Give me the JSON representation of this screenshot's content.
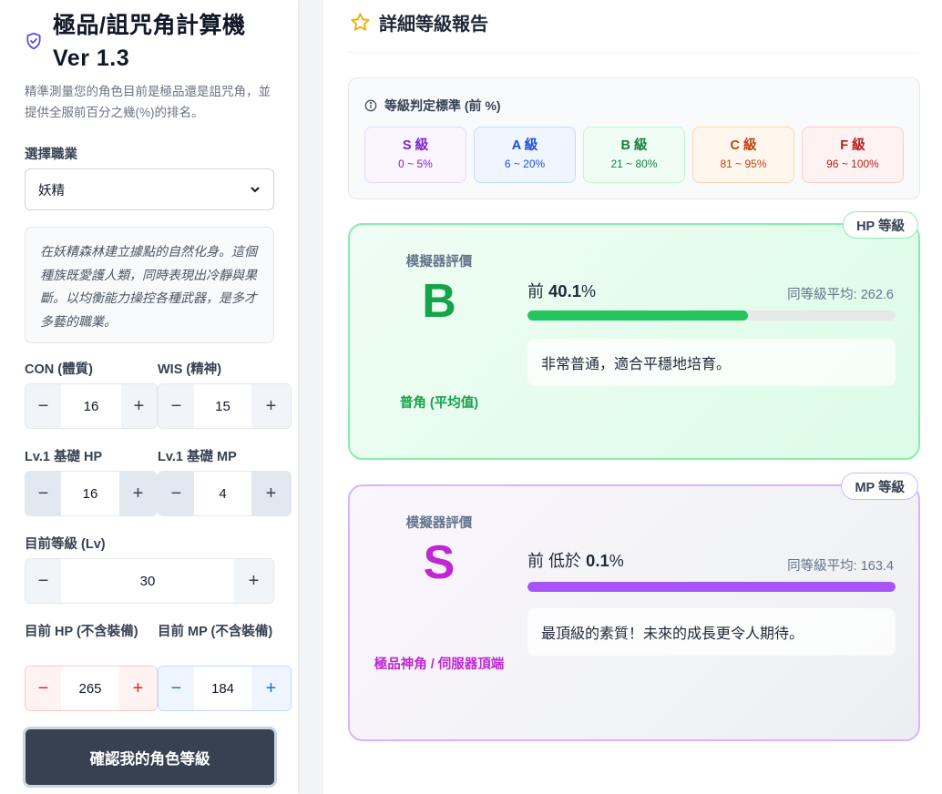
{
  "app": {
    "title": "極品/詛咒角計算機 Ver 1.3",
    "subtitle": "精準測量您的角色目前是極品還是詛咒角，並提供全服前百分之幾(%)的排名。"
  },
  "job": {
    "label": "選擇職業",
    "selected": "妖精",
    "description": "在妖精森林建立據點的自然化身。這個種族既愛護人類，同時表現出冷靜與果斷。以均衡能力操控各種武器，是多才多藝的職業。"
  },
  "stats": {
    "con": {
      "label": "CON (體質)",
      "value": "16"
    },
    "wis": {
      "label": "WIS (精神)",
      "value": "15"
    },
    "base_hp": {
      "label": "Lv.1 基礎 HP",
      "value": "16"
    },
    "base_mp": {
      "label": "Lv.1 基礎 MP",
      "value": "4"
    },
    "level": {
      "label": "目前等級 (Lv)",
      "value": "30"
    },
    "cur_hp": {
      "label": "目前 HP (不含裝備)",
      "value": "265"
    },
    "cur_mp": {
      "label": "目前 MP (不含裝備)",
      "value": "184"
    },
    "minus": "−",
    "plus": "+"
  },
  "confirm_label": "確認我的角色等級",
  "report": {
    "title": "詳細等級報告",
    "criteria_title": "等級判定標準 (前 %)",
    "grades": [
      {
        "name": "S 級",
        "range": "0 ~ 5%",
        "color": "#7e22ce",
        "bg": "#faf5ff",
        "border": "#e9d5ff"
      },
      {
        "name": "A 級",
        "range": "6 ~ 20%",
        "color": "#1d4ed8",
        "bg": "#eff6ff",
        "border": "#bfdbfe"
      },
      {
        "name": "B 級",
        "range": "21 ~ 80%",
        "color": "#15803d",
        "bg": "#f0fdf4",
        "border": "#bbf7d0"
      },
      {
        "name": "C 級",
        "range": "81 ~ 95%",
        "color": "#c2410c",
        "bg": "#fff7ed",
        "border": "#fed7aa"
      },
      {
        "name": "F 級",
        "range": "96 ~ 100%",
        "color": "#b91c1c",
        "bg": "#fef2f2",
        "border": "#fecaca"
      }
    ],
    "hp": {
      "badge": "HP 等級",
      "eval_label": "模擬器評價",
      "grade": "B",
      "tier": "普角 (平均值)",
      "pct_prefix": "前",
      "pct_value": "40.1",
      "pct_unit": "%",
      "progress": 0.599,
      "avg": "同等級平均: 262.6",
      "comment": "非常普通，適合平穩地培育。",
      "accent": "#16a34a",
      "bar_color": "#22c55e"
    },
    "mp": {
      "badge": "MP 等級",
      "eval_label": "模擬器評價",
      "grade": "S",
      "tier": "極品神角 / 伺服器頂端",
      "pct_prefix": "前 低於",
      "pct_value": "0.1",
      "pct_unit": "%",
      "progress": 0.999,
      "avg": "同等級平均: 163.4",
      "comment": "最頂級的素質！未來的成長更令人期待。",
      "accent": "#c026d3",
      "bar_color": "#a855f7"
    }
  }
}
